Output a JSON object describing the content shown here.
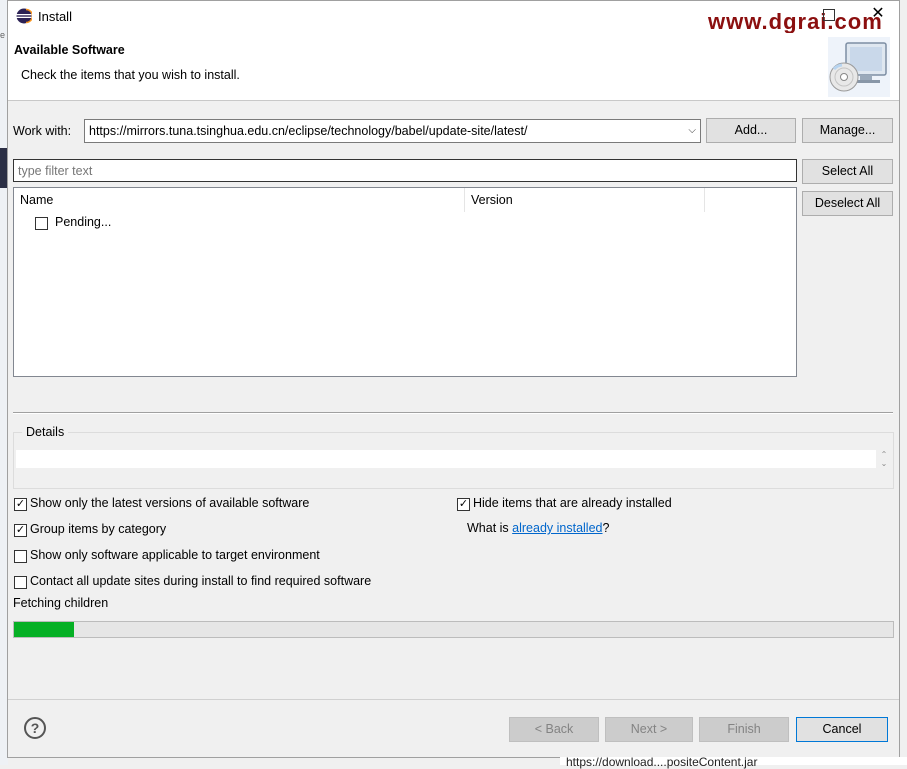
{
  "window": {
    "title": "Install",
    "watermark": "www.dgrai.com"
  },
  "header": {
    "title": "Available Software",
    "description": "Check the items that you wish to install."
  },
  "work_with": {
    "label": "Work with:",
    "value": "https://mirrors.tuna.tsinghua.edu.cn/eclipse/technology/babel/update-site/latest/",
    "add_label": "Add...",
    "manage_label": "Manage..."
  },
  "filter": {
    "placeholder": "type filter text"
  },
  "select_all_label": "Select All",
  "deselect_all_label": "Deselect All",
  "tree": {
    "columns": [
      "Name",
      "Version"
    ],
    "rows": [
      {
        "label": "Pending...",
        "checked": false
      }
    ]
  },
  "details": {
    "label": "Details",
    "text": ""
  },
  "options": {
    "latest_versions": {
      "label": "Show only the latest versions of available software",
      "checked": true
    },
    "group_by_category": {
      "label": "Group items by category",
      "checked": true
    },
    "applicable_target": {
      "label": "Show only software applicable to target environment",
      "checked": false
    },
    "contact_all_sites": {
      "label": "Contact all update sites during install to find required software",
      "checked": false
    },
    "hide_installed": {
      "label": "Hide items that are already installed",
      "checked": true
    }
  },
  "installed_query": {
    "prefix": "What is ",
    "link": "already installed",
    "suffix": "?"
  },
  "status": {
    "text": "Fetching children",
    "progress_fraction": 0.068,
    "progress_color": "#06b025"
  },
  "footer": {
    "back_label": "< Back",
    "next_label": "Next >",
    "finish_label": "Finish",
    "cancel_label": "Cancel"
  },
  "background_fragment": "https://download....positeContent.jar",
  "icons": {
    "title": "eclipse-icon",
    "header": "install-cd-monitor-icon",
    "help": "help-icon"
  }
}
